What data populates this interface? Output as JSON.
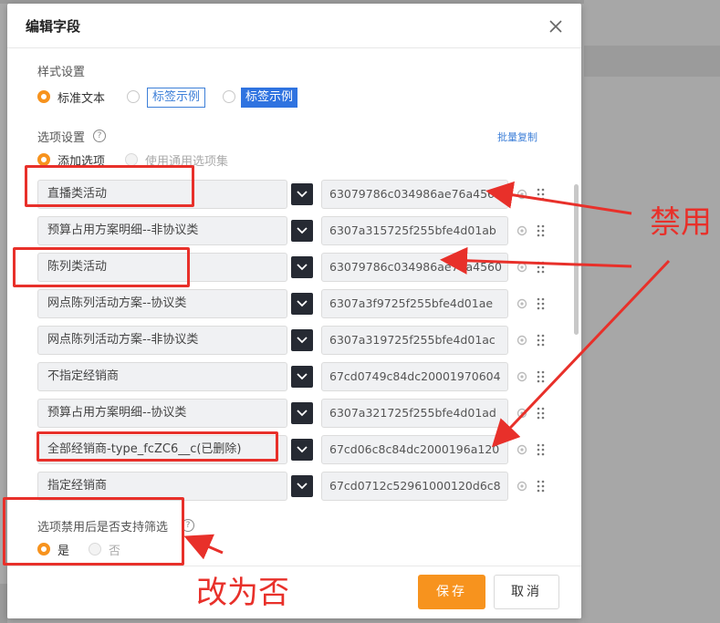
{
  "dialog": {
    "title": "编辑字段"
  },
  "style_settings": {
    "label": "样式设置",
    "options": [
      "标准文本",
      "标签示例",
      "标签示例"
    ],
    "selected_index": 0
  },
  "option_settings": {
    "label": "选项设置",
    "batch_copy_link": "批量复制",
    "source_options": [
      "添加选项",
      "使用通用选项集"
    ],
    "selected_index": 0
  },
  "options": [
    {
      "name": "直播类活动",
      "id": "63079786c034986ae76a4561"
    },
    {
      "name": "预算占用方案明细--非协议类",
      "id": "6307a315725f255bfe4d01ab"
    },
    {
      "name": "陈列类活动",
      "id": "63079786c034986ae76a4560"
    },
    {
      "name": "网点陈列活动方案--协议类",
      "id": "6307a3f9725f255bfe4d01ae"
    },
    {
      "name": "网点陈列活动方案--非协议类",
      "id": "6307a319725f255bfe4d01ac"
    },
    {
      "name": "不指定经销商",
      "id": "67cd0749c84dc20001970604"
    },
    {
      "name": "预算占用方案明细--协议类",
      "id": "6307a321725f255bfe4d01ad"
    },
    {
      "name": "全部经销商-type_fcZC6__c(已删除)",
      "id": "67cd06c8c84dc2000196a120"
    },
    {
      "name": "指定经销商",
      "id": "67cd0712c52961000120d6c8"
    }
  ],
  "filter_setting": {
    "label": "选项禁用后是否支持筛选",
    "options": [
      "是",
      "否"
    ],
    "selected_index": 0
  },
  "footer": {
    "save_label": "保存",
    "cancel_label": "取消"
  },
  "annotations": {
    "disabled_note": "禁用",
    "change_note": "改为否",
    "color": "#e8302a"
  },
  "colors": {
    "accent": "#f7931e",
    "link": "#3d7fd8",
    "tag_fill": "#2f73e0",
    "swatch": "#262a33"
  }
}
